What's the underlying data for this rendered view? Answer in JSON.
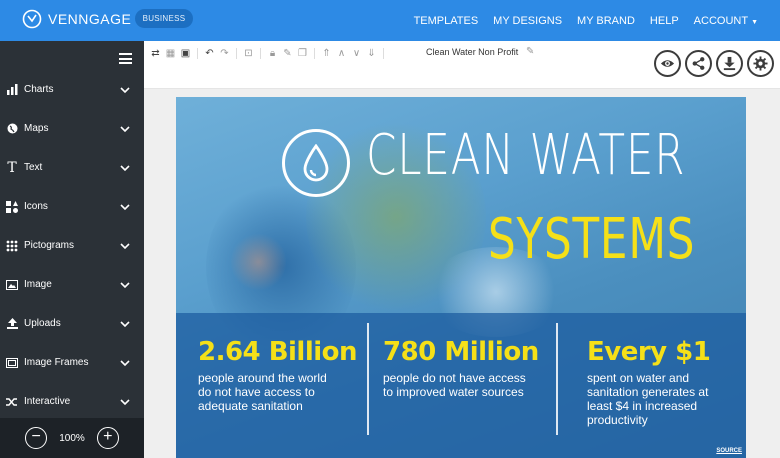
{
  "app": {
    "brand": "VENNGAGE",
    "plan_badge": "BUSINESS",
    "nav": [
      "TEMPLATES",
      "MY DESIGNS",
      "MY BRAND",
      "HELP",
      "ACCOUNT"
    ]
  },
  "sidebar": {
    "items": [
      {
        "label": "Charts",
        "icon": "bar-chart-icon"
      },
      {
        "label": "Maps",
        "icon": "globe-icon"
      },
      {
        "label": "Text",
        "icon": "text-icon"
      },
      {
        "label": "Icons",
        "icon": "shapes-icon"
      },
      {
        "label": "Pictograms",
        "icon": "grid-dots-icon"
      },
      {
        "label": "Image",
        "icon": "image-icon"
      },
      {
        "label": "Uploads",
        "icon": "upload-icon"
      },
      {
        "label": "Image Frames",
        "icon": "frame-icon"
      },
      {
        "label": "Interactive",
        "icon": "shuffle-icon"
      }
    ],
    "zoom": "100%"
  },
  "toolbar": {
    "document_name": "Clean Water Non Profit"
  },
  "infographic": {
    "title_line1": "CLEAN WATER",
    "title_line2": "SYSTEMS",
    "stats": [
      {
        "value": "2.64 Billion",
        "desc": "people around the world do not have access to adequate sanitation"
      },
      {
        "value": "780 Million",
        "desc": "people do not have access to improved water sources"
      },
      {
        "value": "Every $1",
        "desc": "spent on water and sanitation generates at least $4 in increased productivity"
      }
    ],
    "source_label": "SOURCE"
  },
  "colors": {
    "topbar": "#2d8ae5",
    "sidebar": "#2b3137",
    "accent_yellow": "#f5e018",
    "panel_blue": "#1c5ca0"
  }
}
